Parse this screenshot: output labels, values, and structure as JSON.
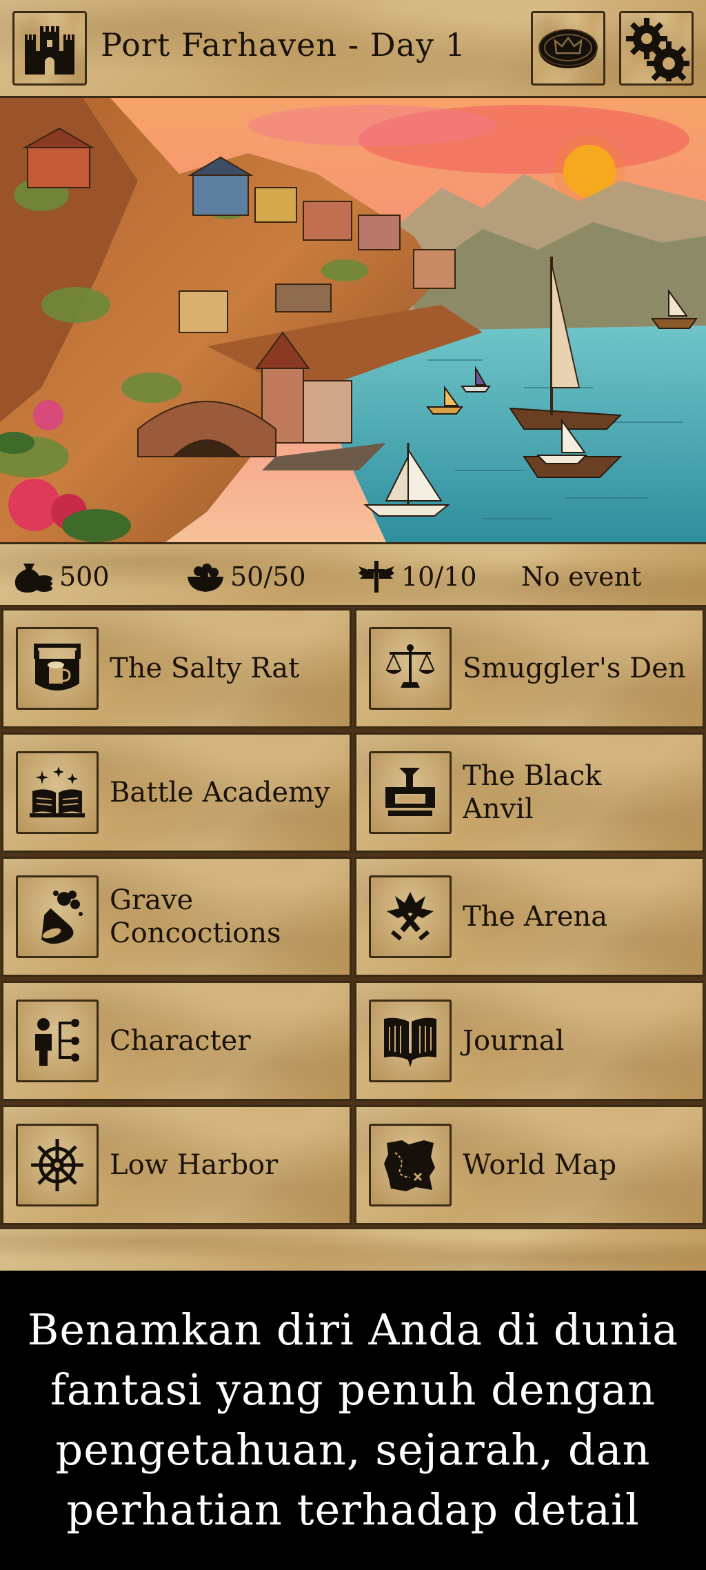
{
  "header": {
    "location_title": "Port Farhaven - Day 1",
    "castle_icon": "castle-icon",
    "coin_icon": "crown-coin-icon",
    "settings_icon": "gears-icon"
  },
  "stats": {
    "gold": "500",
    "food": "50/50",
    "guards": "10/10",
    "event": "No event"
  },
  "locations": [
    {
      "label": "The Salty Rat",
      "icon": "tavern-sign-icon"
    },
    {
      "label": "Smuggler's Den",
      "icon": "scales-icon"
    },
    {
      "label": "Battle Academy",
      "icon": "open-book-icon"
    },
    {
      "label": "The Black Anvil",
      "icon": "anvil-icon"
    },
    {
      "label": "Grave Concoctions",
      "icon": "potion-flask-icon"
    },
    {
      "label": "The Arena",
      "icon": "crossed-swords-icon"
    },
    {
      "label": "Character",
      "icon": "character-tree-icon"
    },
    {
      "label": "Journal",
      "icon": "journal-book-icon"
    },
    {
      "label": "Low Harbor",
      "icon": "ship-wheel-icon"
    },
    {
      "label": "World Map",
      "icon": "treasure-map-icon"
    }
  ],
  "caption": "Benamkan diri Anda di dunia fantasi yang penuh dengan pengetahuan, sejarah, dan perhatian terhadap detail",
  "colors": {
    "parchment": "#c9a76c",
    "ink": "#1a1208",
    "border": "#3b2a14",
    "caption_bg": "#000000",
    "caption_text": "#ffffff"
  }
}
